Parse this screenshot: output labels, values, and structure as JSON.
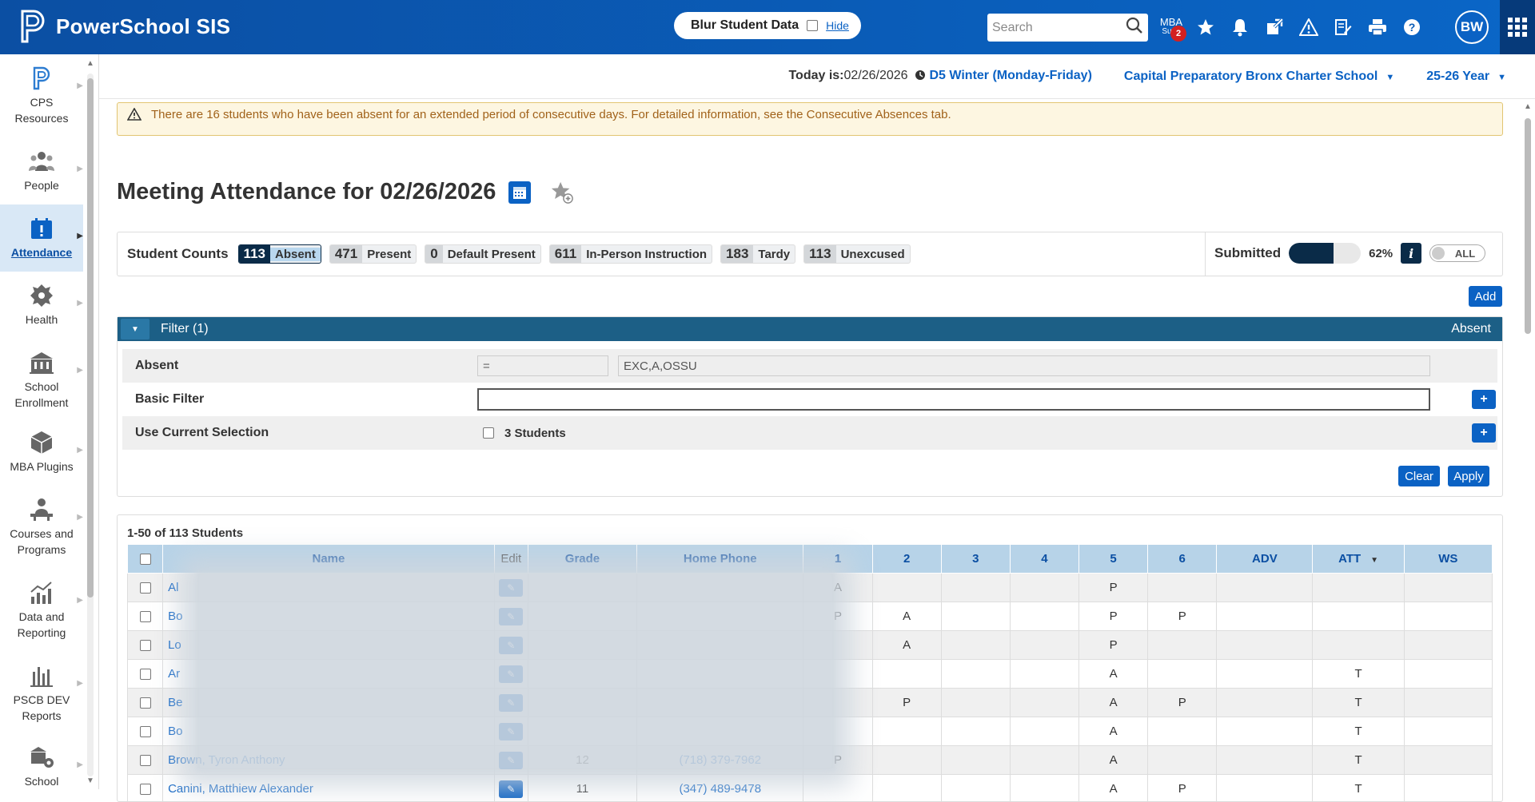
{
  "header": {
    "app_name": "PowerSchool SIS",
    "blur_label": "Blur Student Data",
    "hide_label": "Hide",
    "search_placeholder": "Search",
    "mba_label_1": "MBA",
    "mba_label_2": "Supp",
    "mba_badge": "2",
    "avatar_initials": "BW"
  },
  "sidebar": {
    "items": [
      {
        "label_1": "CPS",
        "label_2": "Resources"
      },
      {
        "label_1": "People",
        "label_2": ""
      },
      {
        "label_1": "Attendance",
        "label_2": ""
      },
      {
        "label_1": "Health",
        "label_2": ""
      },
      {
        "label_1": "School",
        "label_2": "Enrollment"
      },
      {
        "label_1": "MBA Plugins",
        "label_2": ""
      },
      {
        "label_1": "Courses and",
        "label_2": "Programs"
      },
      {
        "label_1": "Data and",
        "label_2": "Reporting"
      },
      {
        "label_1": "PSCB DEV",
        "label_2": "Reports"
      },
      {
        "label_1": "School",
        "label_2": ""
      }
    ]
  },
  "infobar": {
    "today_label": "Today is:",
    "today_value": "02/26/2026",
    "term": "D5 Winter (Monday-Friday)",
    "school": "Capital Preparatory Bronx Charter School",
    "year": "25-26 Year"
  },
  "alert": {
    "text": "There are 16 students who have been absent for an extended period of consecutive days. For detailed information, see the Consecutive Absences tab."
  },
  "page": {
    "title": "Meeting Attendance for 02/26/2026"
  },
  "counts": {
    "label": "Student Counts",
    "chips": [
      {
        "num": "113",
        "label": "Absent"
      },
      {
        "num": "471",
        "label": "Present"
      },
      {
        "num": "0",
        "label": "Default Present"
      },
      {
        "num": "611",
        "label": "In-Person Instruction"
      },
      {
        "num": "183",
        "label": "Tardy"
      },
      {
        "num": "113",
        "label": "Unexcused"
      }
    ],
    "submitted_label": "Submitted",
    "submitted_pct": "62%",
    "submitted_fraction": 0.62,
    "toggle_label": "ALL"
  },
  "buttons": {
    "add": "Add",
    "clear": "Clear",
    "apply": "Apply"
  },
  "filter": {
    "title": "Filter (1)",
    "right_label": "Absent",
    "rows": {
      "absent_label": "Absent",
      "absent_op": "=",
      "absent_value": "EXC,A,OSSU",
      "basic_label": "Basic Filter",
      "selection_label": "Use Current Selection",
      "selection_count": "3 Students"
    }
  },
  "table": {
    "count_text": "1-50 of 113 Students",
    "headers": {
      "name": "Name",
      "edit": "Edit",
      "grade": "Grade",
      "phone": "Home Phone",
      "p1": "1",
      "p2": "2",
      "p3": "3",
      "p4": "4",
      "p5": "5",
      "p6": "6",
      "adv": "ADV",
      "att": "ATT",
      "ws": "WS"
    },
    "rows": [
      {
        "name": "Al",
        "grade": "",
        "phone": "",
        "p1": "A",
        "p2": "",
        "p3": "",
        "p4": "",
        "p5": "P",
        "p6": "",
        "adv": "",
        "att": "",
        "ws": ""
      },
      {
        "name": "Bo",
        "grade": "",
        "phone": "",
        "p1": "P",
        "p2": "A",
        "p3": "",
        "p4": "",
        "p5": "P",
        "p6": "P",
        "adv": "",
        "att": "",
        "ws": ""
      },
      {
        "name": "Lo",
        "grade": "",
        "phone": "",
        "p1": "",
        "p2": "A",
        "p3": "",
        "p4": "",
        "p5": "P",
        "p6": "",
        "adv": "",
        "att": "",
        "ws": ""
      },
      {
        "name": "Ar",
        "grade": "",
        "phone": "",
        "p1": "",
        "p2": "",
        "p3": "",
        "p4": "",
        "p5": "A",
        "p6": "",
        "adv": "",
        "att": "T",
        "ws": ""
      },
      {
        "name": "Be",
        "grade": "",
        "phone": "",
        "p1": "",
        "p2": "P",
        "p3": "",
        "p4": "",
        "p5": "A",
        "p6": "P",
        "adv": "",
        "att": "T",
        "ws": ""
      },
      {
        "name": "Bo",
        "grade": "",
        "phone": "",
        "p1": "",
        "p2": "",
        "p3": "",
        "p4": "",
        "p5": "A",
        "p6": "",
        "adv": "",
        "att": "T",
        "ws": ""
      },
      {
        "name": "Brown, Tyron Anthony",
        "grade": "12",
        "phone": "(718) 379-7962",
        "p1": "P",
        "p2": "",
        "p3": "",
        "p4": "",
        "p5": "A",
        "p6": "",
        "adv": "",
        "att": "T",
        "ws": ""
      },
      {
        "name": "Canini, Matthiew Alexander",
        "grade": "11",
        "phone": "(347) 489-9478",
        "p1": "",
        "p2": "",
        "p3": "",
        "p4": "",
        "p5": "A",
        "p6": "P",
        "adv": "",
        "att": "T",
        "ws": ""
      }
    ]
  }
}
